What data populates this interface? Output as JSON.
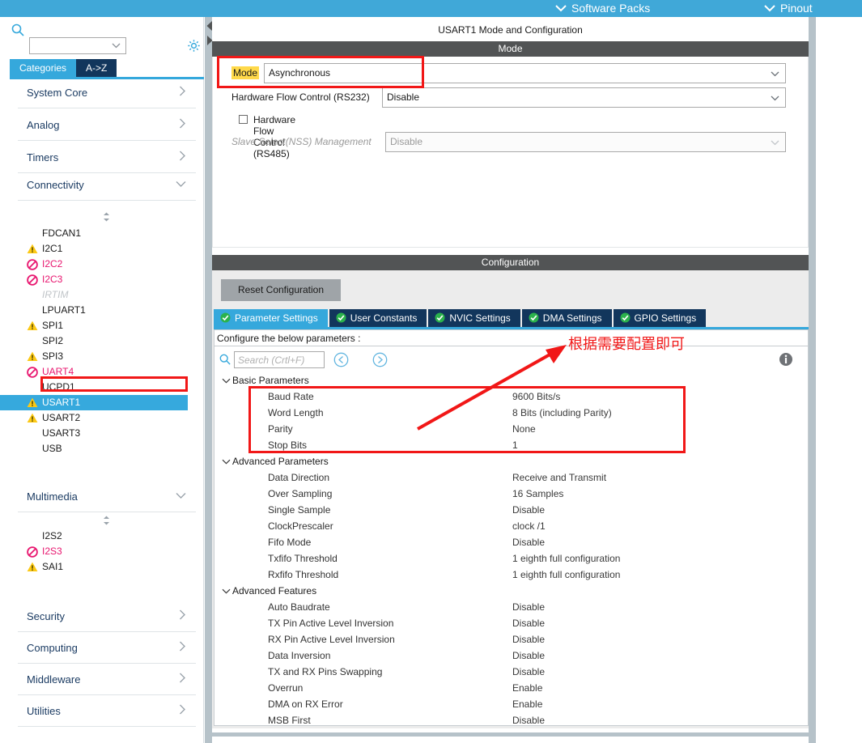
{
  "topbar": {
    "software_packs": "Software Packs",
    "pinout": "Pinout",
    "chevron": "⌄"
  },
  "sidebar": {
    "search_placeholder": "",
    "search_value": "",
    "tabs": [
      {
        "label": "Categories",
        "active": true
      },
      {
        "label": "A->Z",
        "active": false
      }
    ],
    "categories": [
      {
        "label": "System Core",
        "expanded": false
      },
      {
        "label": "Analog",
        "expanded": false
      },
      {
        "label": "Timers",
        "expanded": false
      },
      {
        "label": "Connectivity",
        "expanded": true
      }
    ],
    "connectivity_items": [
      {
        "label": "FDCAN1",
        "status": "none"
      },
      {
        "label": "I2C1",
        "status": "warning"
      },
      {
        "label": "I2C2",
        "status": "forbidden"
      },
      {
        "label": "I2C3",
        "status": "forbidden"
      },
      {
        "label": "IRTIM",
        "status": "disabled"
      },
      {
        "label": "LPUART1",
        "status": "none"
      },
      {
        "label": "SPI1",
        "status": "warning"
      },
      {
        "label": "SPI2",
        "status": "none"
      },
      {
        "label": "SPI3",
        "status": "warning"
      },
      {
        "label": "UART4",
        "status": "forbidden"
      },
      {
        "label": "UCPD1",
        "status": "none"
      },
      {
        "label": "USART1",
        "status": "warning",
        "selected": true
      },
      {
        "label": "USART2",
        "status": "warning"
      },
      {
        "label": "USART3",
        "status": "none"
      },
      {
        "label": "USB",
        "status": "none"
      }
    ],
    "multimedia": {
      "label": "Multimedia",
      "expanded": true
    },
    "multimedia_items": [
      {
        "label": "I2S2",
        "status": "none"
      },
      {
        "label": "I2S3",
        "status": "forbidden"
      },
      {
        "label": "SAI1",
        "status": "warning"
      }
    ],
    "categories_bottom": [
      {
        "label": "Security",
        "expanded": false
      },
      {
        "label": "Computing",
        "expanded": false
      },
      {
        "label": "Middleware",
        "expanded": false
      },
      {
        "label": "Utilities",
        "expanded": false
      }
    ]
  },
  "main": {
    "panel_title": "USART1 Mode and Configuration",
    "mode_section_title": "Mode",
    "config_section_title": "Configuration",
    "mode_fields": [
      {
        "label": "Mode",
        "value": "Asynchronous",
        "highlighted": true,
        "dropdown": true,
        "enabled": true
      },
      {
        "label": "Hardware Flow Control (RS232)",
        "value": "Disable",
        "highlighted": false,
        "dropdown": true,
        "enabled": true
      },
      {
        "label": "Slave Select(NSS) Management",
        "value": "Disable",
        "highlighted": false,
        "dropdown": true,
        "enabled": false
      }
    ],
    "checkbox": {
      "label": "Hardware Flow Control (RS485)",
      "checked": false
    },
    "reset_button": "Reset Configuration",
    "config_tabs": [
      {
        "label": "Parameter Settings",
        "active": true
      },
      {
        "label": "User Constants",
        "active": false
      },
      {
        "label": "NVIC Settings",
        "active": false
      },
      {
        "label": "DMA Settings",
        "active": false
      },
      {
        "label": "GPIO Settings",
        "active": false
      }
    ],
    "configure_note": "Configure the below parameters :",
    "search_placeholder": "Search (Crtl+F)",
    "groups": [
      {
        "name": "Basic Parameters",
        "rows": [
          {
            "key": "Baud Rate",
            "value": "9600 Bits/s"
          },
          {
            "key": "Word Length",
            "value": "8 Bits (including Parity)"
          },
          {
            "key": "Parity",
            "value": "None"
          },
          {
            "key": "Stop Bits",
            "value": "1"
          }
        ]
      },
      {
        "name": "Advanced Parameters",
        "rows": [
          {
            "key": "Data Direction",
            "value": "Receive and Transmit"
          },
          {
            "key": "Over Sampling",
            "value": "16 Samples"
          },
          {
            "key": "Single Sample",
            "value": "Disable"
          },
          {
            "key": "ClockPrescaler",
            "value": "clock /1"
          },
          {
            "key": "Fifo Mode",
            "value": "Disable"
          },
          {
            "key": "Txfifo Threshold",
            "value": "1 eighth full configuration"
          },
          {
            "key": "Rxfifo Threshold",
            "value": "1 eighth full configuration"
          }
        ]
      },
      {
        "name": "Advanced Features",
        "rows": [
          {
            "key": "Auto Baudrate",
            "value": "Disable"
          },
          {
            "key": "TX Pin Active Level Inversion",
            "value": "Disable"
          },
          {
            "key": "RX Pin Active Level Inversion",
            "value": "Disable"
          },
          {
            "key": "Data Inversion",
            "value": "Disable"
          },
          {
            "key": "TX and RX Pins Swapping",
            "value": "Disable"
          },
          {
            "key": "Overrun",
            "value": "Enable"
          },
          {
            "key": "DMA on RX Error",
            "value": "Enable"
          },
          {
            "key": "MSB First",
            "value": "Disable"
          }
        ]
      }
    ]
  },
  "annotations": {
    "note_text": "根据需要配置即可",
    "color": "#f11717"
  },
  "colors": {
    "topbar": "#40a8d8",
    "accent_blue": "#35a8dc",
    "tab_dark": "#12365c",
    "section_gray": "#525455",
    "warning_yellow": "#fcc915",
    "forbidden_pink": "#e8166f",
    "highlight_gold": "#ffd94a",
    "annotation_red": "#f11717"
  }
}
